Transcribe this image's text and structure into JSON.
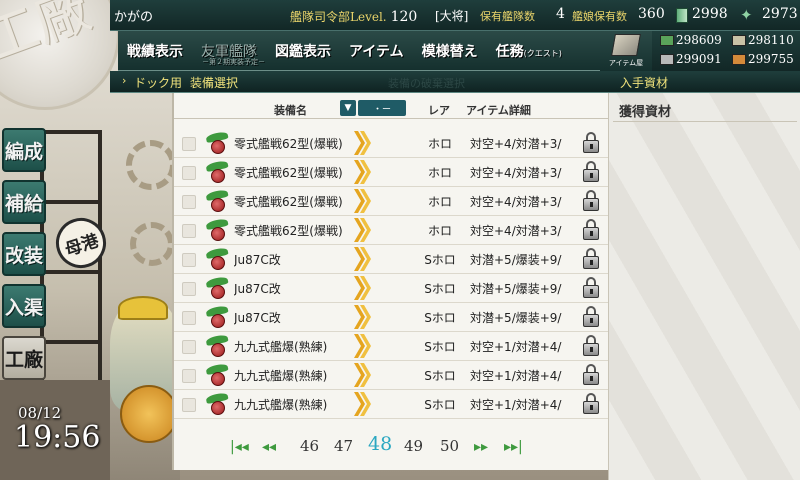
{
  "header": {
    "admiral_name": "かがの",
    "hq_label": "艦隊司令部Level.",
    "hq_level": "120",
    "rank": "[大将]",
    "fleet_label": "保有艦隊数",
    "fleet_count": "4",
    "ship_label": "艦娘保有数",
    "ship_count": "360",
    "buckets": "2998",
    "torches": "2973"
  },
  "menu": {
    "items": [
      {
        "label": "戦績表示"
      },
      {
        "label": "友軍艦隊",
        "sub": "－第２期実装予定－"
      },
      {
        "label": "図鑑表示"
      },
      {
        "label": "アイテム"
      },
      {
        "label": "模様替え"
      },
      {
        "label": "任務",
        "small": "(クエスト)"
      }
    ],
    "shop_label": "アイテム屋"
  },
  "resources": {
    "fuel": "298609",
    "ammo": "298110",
    "steel": "299091",
    "bauxite": "299755"
  },
  "subheader": {
    "dock_label": "ドック用",
    "select_label": "装備選択",
    "faint_label": "装備の破棄選択",
    "gain_label": "入手資材"
  },
  "table": {
    "col_name": "装備名",
    "sort_icon": "▼",
    "sort_mode": "・ー",
    "col_rarity": "レア",
    "col_detail": "アイテム詳細",
    "rows": [
      {
        "name": "零式艦戦62型(爆戦)",
        "rarity": "ホロ",
        "detail": "対空+4/対潜+3/"
      },
      {
        "name": "零式艦戦62型(爆戦)",
        "rarity": "ホロ",
        "detail": "対空+4/対潜+3/"
      },
      {
        "name": "零式艦戦62型(爆戦)",
        "rarity": "ホロ",
        "detail": "対空+4/対潜+3/"
      },
      {
        "name": "零式艦戦62型(爆戦)",
        "rarity": "ホロ",
        "detail": "対空+4/対潜+3/"
      },
      {
        "name": "Ju87C改",
        "rarity": "Sホロ",
        "detail": "対潜+5/爆装+9/"
      },
      {
        "name": "Ju87C改",
        "rarity": "Sホロ",
        "detail": "対潜+5/爆装+9/"
      },
      {
        "name": "Ju87C改",
        "rarity": "Sホロ",
        "detail": "対潜+5/爆装+9/"
      },
      {
        "name": "九九式艦爆(熟練)",
        "rarity": "Sホロ",
        "detail": "対空+1/対潜+4/"
      },
      {
        "name": "九九式艦爆(熟練)",
        "rarity": "Sホロ",
        "detail": "対空+1/対潜+4/"
      },
      {
        "name": "九九式艦爆(熟練)",
        "rarity": "Sホロ",
        "detail": "対空+1/対潜+4/"
      }
    ]
  },
  "pager": {
    "pages": [
      "46",
      "47",
      "48",
      "49",
      "50"
    ],
    "current": "48"
  },
  "gain_panel": {
    "title": "獲得資材"
  },
  "side_nav": {
    "items": [
      "編成",
      "補給",
      "改装",
      "入渠",
      "工廠"
    ],
    "seal": "母港"
  },
  "background": {
    "badge": "工廠"
  },
  "clock": {
    "date": "08/12",
    "time": "19:56"
  },
  "colors": {
    "accent": "#2aa7c1",
    "header_bg": "#1f3e3c",
    "header_text": "#e9d46a",
    "nav_green": "#3c7a70"
  }
}
